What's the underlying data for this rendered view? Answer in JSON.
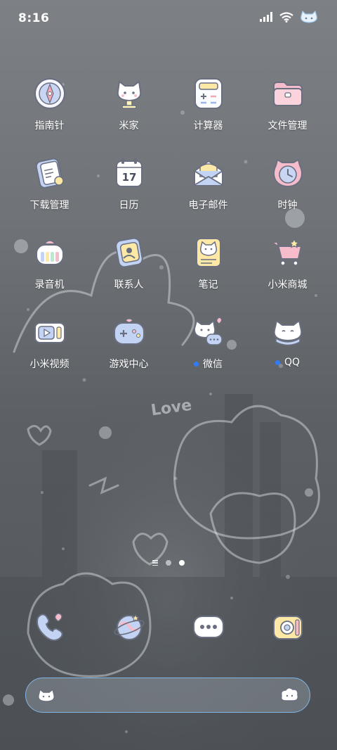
{
  "status_bar": {
    "time": "8:16"
  },
  "apps": [
    [
      {
        "label": "指南针",
        "icon": "compass-icon"
      },
      {
        "label": "米家",
        "icon": "mijia-icon"
      },
      {
        "label": "计算器",
        "icon": "calculator-icon"
      },
      {
        "label": "文件管理",
        "icon": "folder-icon"
      }
    ],
    [
      {
        "label": "下载管理",
        "icon": "download-icon"
      },
      {
        "label": "日历",
        "icon": "calendar-icon",
        "day": "17"
      },
      {
        "label": "电子邮件",
        "icon": "mail-icon"
      },
      {
        "label": "时钟",
        "icon": "clock-icon"
      }
    ],
    [
      {
        "label": "录音机",
        "icon": "recorder-icon"
      },
      {
        "label": "联系人",
        "icon": "contacts-icon"
      },
      {
        "label": "笔记",
        "icon": "notes-icon"
      },
      {
        "label": "小米商城",
        "icon": "shop-icon"
      }
    ],
    [
      {
        "label": "小米视频",
        "icon": "video-icon"
      },
      {
        "label": "游戏中心",
        "icon": "game-icon"
      },
      {
        "label": "微信",
        "icon": "wechat-icon",
        "badge": true
      },
      {
        "label": "QQ",
        "icon": "qq-icon",
        "badge": true
      }
    ]
  ],
  "background_text": "Love",
  "dock": [
    {
      "icon": "phone-icon"
    },
    {
      "icon": "browser-icon"
    },
    {
      "icon": "messages-icon"
    },
    {
      "icon": "camera-icon"
    }
  ],
  "colors": {
    "badge": "#2f7cf6",
    "search_border": "#7fb6e6"
  }
}
